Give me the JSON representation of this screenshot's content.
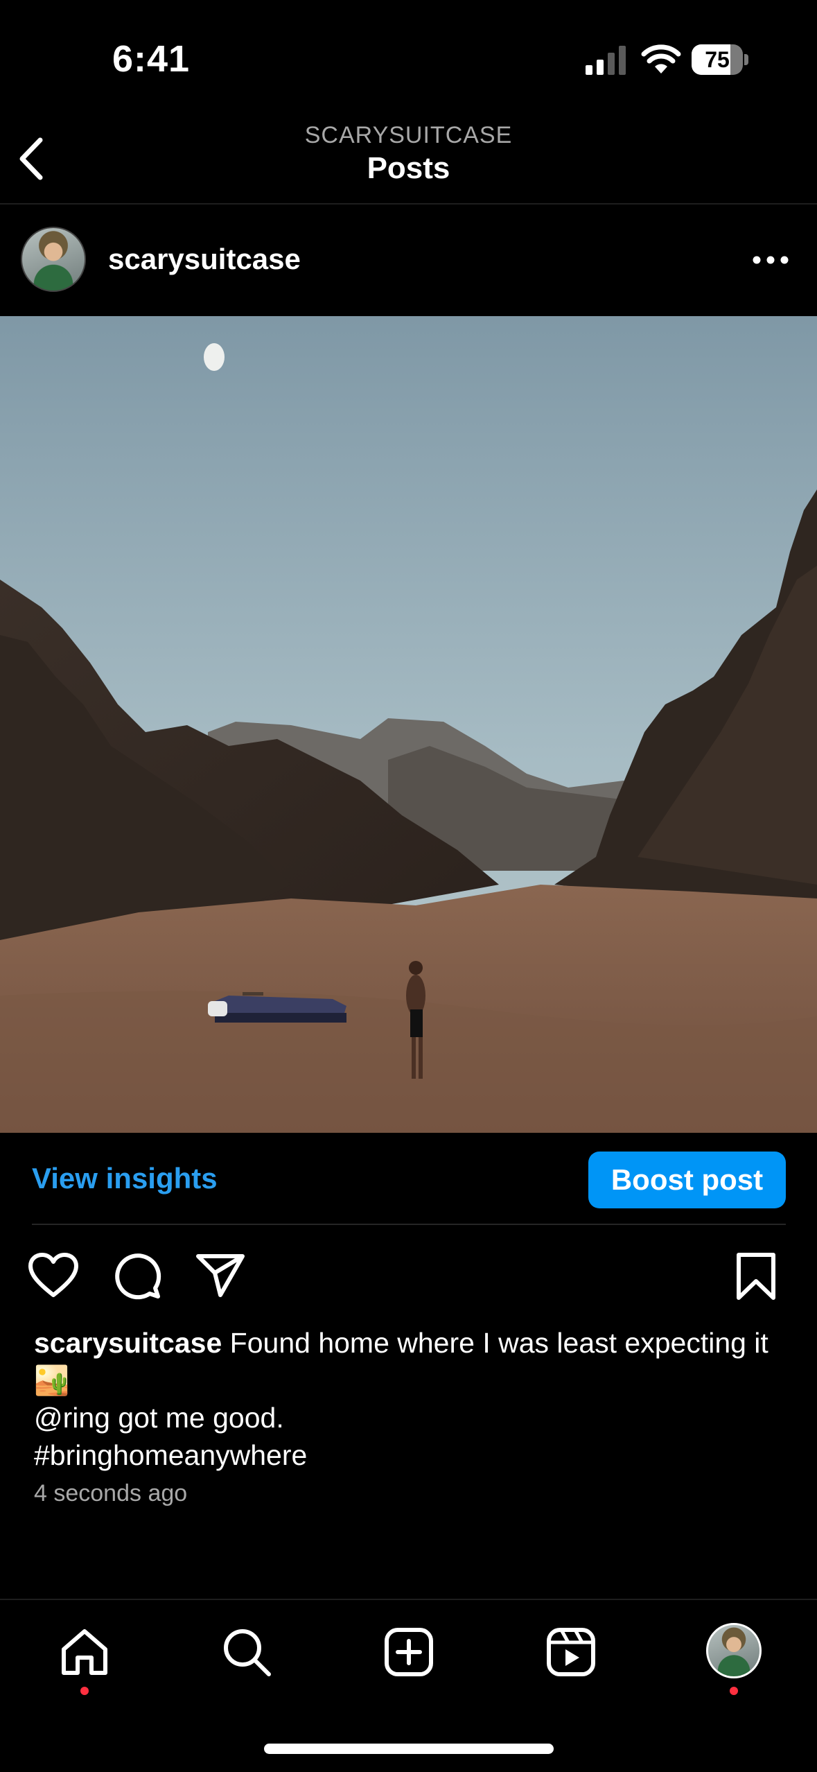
{
  "status_bar": {
    "time": "6:41",
    "battery_percent": "75",
    "battery_level": 0.75
  },
  "nav": {
    "subtitle": "SCARYSUITCASE",
    "title": "Posts"
  },
  "post": {
    "username": "scarysuitcase",
    "view_insights_label": "View insights",
    "boost_label": "Boost post",
    "caption": {
      "username": "scarysuitcase",
      "text": "Found home where I was least expecting it 🏜️",
      "line2": "@ring got me good.",
      "line3": "#bringhomeanywhere"
    },
    "timestamp": "4 seconds ago"
  },
  "icons": {
    "back": "chevron-left-icon",
    "more": "more-horizontal-icon",
    "like": "heart-icon",
    "comment": "comment-icon",
    "share": "paper-plane-icon",
    "save": "bookmark-icon",
    "tabs": [
      "home-icon",
      "search-icon",
      "create-icon",
      "reels-icon",
      "profile-avatar"
    ]
  },
  "colors": {
    "accent": "#0095f6",
    "link": "#2a9ef0",
    "notification_dot": "#ff3040",
    "secondary_text": "#a8a8a8"
  }
}
